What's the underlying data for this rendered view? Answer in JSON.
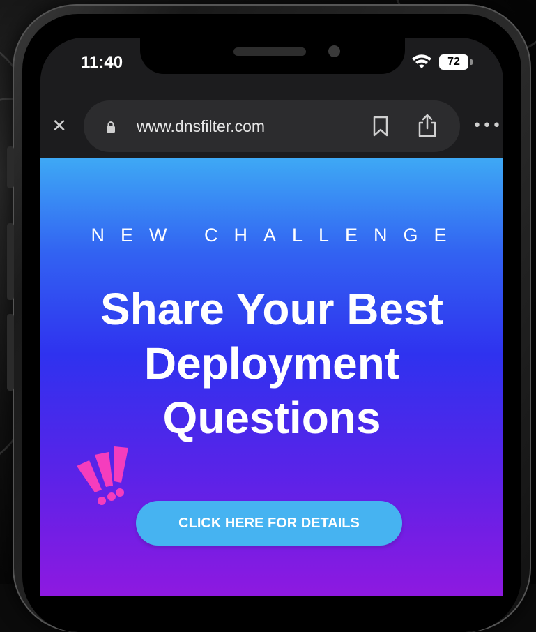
{
  "status_bar": {
    "time": "11:40",
    "battery": "72"
  },
  "browser": {
    "url": "www.dnsfilter.com",
    "close_symbol": "✕",
    "more_symbol": "•••"
  },
  "banner": {
    "eyebrow": "NEW CHALLENGE",
    "headline": "Share Your Best Deployment Questions",
    "cta_label": "CLICK HERE FOR DETAILS",
    "decoration": "exclamation-marks-graphic"
  },
  "colors": {
    "gradient_top": "#3ea9f5",
    "gradient_mid": "#2f32ef",
    "gradient_bottom": "#8e19e0",
    "cta_background": "#46b3f1",
    "accent_pink": "#f53dbd"
  },
  "icons": [
    "close-icon",
    "lock-icon",
    "bookmark-icon",
    "share-icon",
    "more-icon",
    "wifi-icon",
    "battery-icon"
  ]
}
